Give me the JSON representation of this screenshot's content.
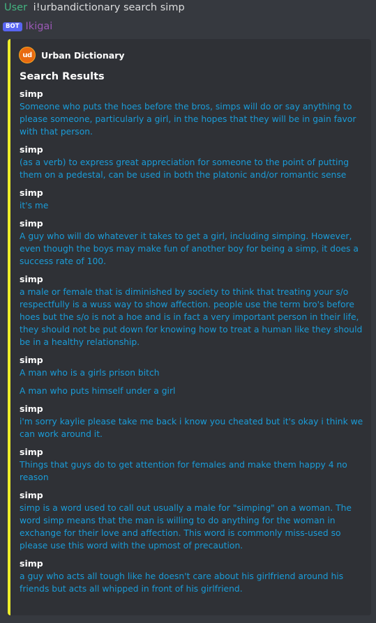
{
  "message": {
    "username": "User",
    "command": "i!urbandictionary search simp",
    "bot_tag": "BOT",
    "bot_name": "Ikigai"
  },
  "embed": {
    "author": "Urban Dictionary",
    "logo_text": "ud",
    "title": "Search Results",
    "accent_color": "#eded2b",
    "value_color": "#1a9cd8",
    "fields": [
      {
        "name": "simp",
        "value": "Someone who puts the hoes before the bros, simps will do or say anything to please someone, particularly a girl, in the hopes that they will be in gain favor with that person."
      },
      {
        "name": "simp",
        "value": "(as a verb) to express great appreciation for someone to the point of putting them on a pedestal, can be used in both the platonic and/or romantic sense"
      },
      {
        "name": "simp",
        "value": "it's me"
      },
      {
        "name": "simp",
        "value": "A guy who will do whatever it takes to get a girl, including simping. However, even though the boys may make fun of another boy for being a simp, it does a success rate of 100."
      },
      {
        "name": "simp",
        "value": "a male or female that is diminished by society to think that treating your s/o respectfully is a wuss way to show affection. people use the term bro's before hoes but the s/o is not a hoe and is in fact a very important person in their life, they should not be put down for knowing how to treat a human like they should be in a healthy relationship."
      },
      {
        "name": "simp",
        "value": "A man who is a girls prison bitch"
      },
      {
        "name": "",
        "value": "A man who puts himself under a girl"
      },
      {
        "name": "simp",
        "value": "i'm sorry kaylie please take me back i know you cheated but it's okay i think we can work around it."
      },
      {
        "name": "simp",
        "value": "Things that guys do to get attention for females and make them happy 4 no reason"
      },
      {
        "name": "simp",
        "value": "simp is a word used to call out usually a male for \"simping\" on a woman. The word simp means that the man is willing to do anything for the woman in exchange for their love and affection. This word is commonly miss-used so please use this word with the upmost of precaution."
      },
      {
        "name": "simp",
        "value": "a guy who acts all tough like he doesn't care about his girlfriend around his friends but acts all whipped in front of his girlfriend."
      }
    ]
  }
}
